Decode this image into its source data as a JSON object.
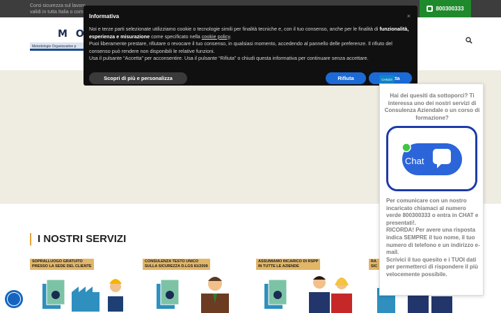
{
  "topbar": {
    "text": "Corsi sicurezza sul lavoro\nvalidi in tutta Italia o com",
    "phone": "800300333"
  },
  "logo": {
    "letters": "MO",
    "subtitle": "Metodologie Organizzative p"
  },
  "cookie": {
    "title": "Informativa",
    "close": "×",
    "p1_start": "Noi e terze parti selezionate utilizziamo cookie o tecnologie simili per finalità tecniche e, con il tuo consenso, anche per le finalità di ",
    "p1_bold": "funzionalità, esperienza e misurazione",
    "p1_mid": " come specificato nella ",
    "p1_link": "cookie policy",
    "p1_end": ".",
    "p2": "Puoi liberamente prestare, rifiutare o revocare il tuo consenso, in qualsiasi momento, accedendo al pannello delle preferenze. Il rifiuto del consenso può rendere non disponibili le relative funzioni.",
    "p3": "Usa il pulsante “Accetta” per acconsentire. Usa il pulsante “Rifiuta” o chiudi questa informativa per continuare senza accettare.",
    "more_label": "Scopri di più e personalizza",
    "reject_label": "Rifiuta",
    "accept_label": "Accetta"
  },
  "services": {
    "title": "I NOSTRI SERVIZI",
    "cards": [
      {
        "label_line1": "SOPRALLUOGO GRATUITO",
        "label_line2": "PRESSO LA SEDE DEL CLIENTE"
      },
      {
        "label_line1": "CONSULENZA TESTO UNICO",
        "label_line2": "SULLA SICUREZZA D.LGS 81/2008"
      },
      {
        "label_line1": "ASSUMIAMO INCARICO DI RSPP",
        "label_line2": "IN TUTTE LE AZIENDE"
      },
      {
        "label_line1": "RA",
        "label_line2": "SIC"
      }
    ]
  },
  "chat": {
    "tab": "CHIUDI",
    "question": "Hai dei quesiti da sottoporci? Ti interessa uno dei nostri servizi di Consulenza Aziendale o un corso di formazione?",
    "bubble_label": "Chat",
    "info": "Per comunicare con un nostro incaricato chiamaci al numero verde 800300333 o entra in CHAT e presentati!.\nRICORDA! Per avere una risposta indica SEMPRE il tuo nome, il tuo numero di telefono e un indirizzo e-mail.\nScrivici il tuo quesito e i TUOI dati per permetterci di rispondere il più velocemente possibile."
  },
  "colors": {
    "accent_orange": "#e8a33b",
    "brand_blue": "#1b6ad6",
    "phone_green": "#1e8a2b"
  }
}
